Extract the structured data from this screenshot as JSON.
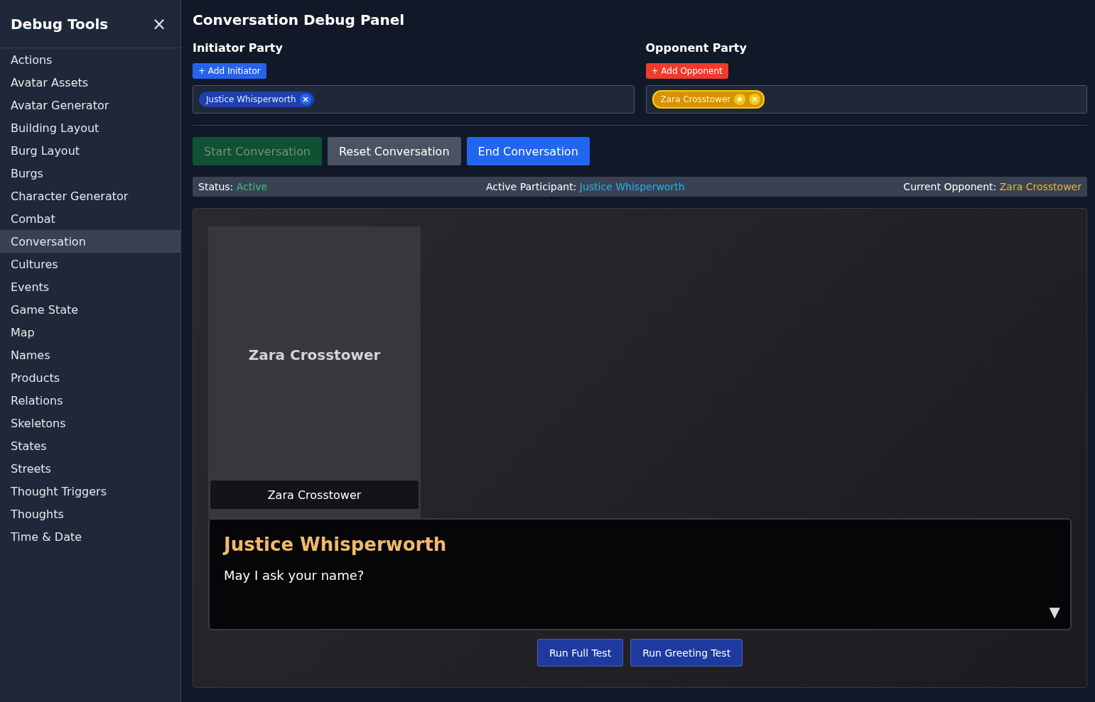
{
  "sidebar": {
    "title": "Debug Tools",
    "close": "×",
    "items": [
      {
        "label": "Actions",
        "selected": false
      },
      {
        "label": "Avatar Assets",
        "selected": false
      },
      {
        "label": "Avatar Generator",
        "selected": false
      },
      {
        "label": "Building Layout",
        "selected": false
      },
      {
        "label": "Burg Layout",
        "selected": false
      },
      {
        "label": "Burgs",
        "selected": false
      },
      {
        "label": "Character Generator",
        "selected": false
      },
      {
        "label": "Combat",
        "selected": false
      },
      {
        "label": "Conversation",
        "selected": true
      },
      {
        "label": "Cultures",
        "selected": false
      },
      {
        "label": "Events",
        "selected": false
      },
      {
        "label": "Game State",
        "selected": false
      },
      {
        "label": "Map",
        "selected": false
      },
      {
        "label": "Names",
        "selected": false
      },
      {
        "label": "Products",
        "selected": false
      },
      {
        "label": "Relations",
        "selected": false
      },
      {
        "label": "Skeletons",
        "selected": false
      },
      {
        "label": "States",
        "selected": false
      },
      {
        "label": "Streets",
        "selected": false
      },
      {
        "label": "Thought Triggers",
        "selected": false
      },
      {
        "label": "Thoughts",
        "selected": false
      },
      {
        "label": "Time & Date",
        "selected": false
      }
    ]
  },
  "panel": {
    "title": "Conversation Debug Panel",
    "parties": [
      {
        "kind": "initiator",
        "title": "Initiator Party",
        "add_button": "+ Add Initiator",
        "chips": [
          {
            "name": "Justice Whisperworth",
            "leader": false
          }
        ]
      },
      {
        "kind": "opponent",
        "title": "Opponent Party",
        "add_button": "+ Add Opponent",
        "chips": [
          {
            "name": "Zara Crosstower",
            "leader": true
          }
        ]
      }
    ],
    "buttons": [
      {
        "kind": "start",
        "label": "Start Conversation",
        "disabled": true
      },
      {
        "kind": "reset",
        "label": "Reset Conversation",
        "disabled": false
      },
      {
        "kind": "end",
        "label": "End Conversation",
        "disabled": false
      }
    ],
    "status": {
      "status_label": "Status:",
      "status_value": "Active",
      "participant_label": "Active Participant:",
      "participant_value": "Justice Whisperworth",
      "opponent_label": "Current Opponent:",
      "opponent_value": "Zara Crosstower"
    },
    "stage": {
      "portrait_name": "Zara Crosstower",
      "nameplate": "Zara Crosstower",
      "dialogue": {
        "speaker": "Justice Whisperworth",
        "text": "May I ask your name?",
        "continue": "▼"
      },
      "test_buttons": [
        "Run Full Test",
        "Run Greeting Test"
      ]
    }
  }
}
